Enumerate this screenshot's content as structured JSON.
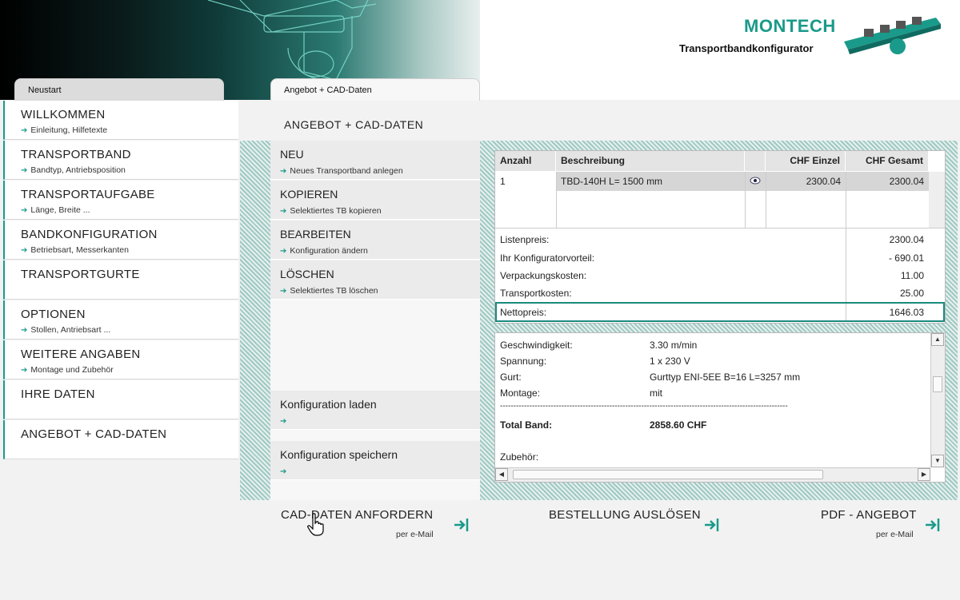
{
  "header": {
    "brand": "MONTECH",
    "subtitle": "Transportbandkonfigurator"
  },
  "tabs": [
    {
      "label": "Neustart"
    },
    {
      "label": "Angebot + CAD-Daten"
    }
  ],
  "left_nav": [
    {
      "title": "WILLKOMMEN",
      "sub": "Einleitung, Hilfetexte"
    },
    {
      "title": "TRANSPORTBAND",
      "sub": "Bandtyp, Antriebsposition"
    },
    {
      "title": "TRANSPORTAUFGABE",
      "sub": "Länge, Breite ..."
    },
    {
      "title": "BANDKONFIGURATION",
      "sub": "Betriebsart, Messerkanten"
    },
    {
      "title": "TRANSPORTGURTE",
      "sub": ""
    },
    {
      "title": "OPTIONEN",
      "sub": "Stollen, Antriebsart ..."
    },
    {
      "title": "WEITERE ANGABEN",
      "sub": "Montage und Zubehör"
    },
    {
      "title": "IHRE DATEN",
      "sub": ""
    },
    {
      "title": "ANGEBOT + CAD-DATEN",
      "sub": ""
    }
  ],
  "content_title": "ANGEBOT + CAD-DATEN",
  "actions": [
    {
      "title": "NEU",
      "sub": "Neues Transportband anlegen"
    },
    {
      "title": "KOPIEREN",
      "sub": "Selektiertes TB kopieren"
    },
    {
      "title": "BEARBEITEN",
      "sub": "Konfiguration ändern"
    },
    {
      "title": "LÖSCHEN",
      "sub": "Selektiertes TB löschen"
    }
  ],
  "config_actions": [
    {
      "title": "Konfiguration laden"
    },
    {
      "title": "Konfiguration speichern"
    }
  ],
  "price_table": {
    "headers": [
      "Anzahl",
      "Beschreibung",
      "CHF Einzel",
      "CHF Gesamt"
    ],
    "rows": [
      {
        "anzahl": "1",
        "beschreibung": "TBD-140H L= 1500 mm",
        "einzel": "2300.04",
        "gesamt": "2300.04"
      }
    ],
    "summary": [
      {
        "label": "Listenpreis:",
        "value": "2300.04"
      },
      {
        "label": "Ihr Konfiguratorvorteil:",
        "value": "- 690.01"
      },
      {
        "label": "Verpackungskosten:",
        "value": "11.00"
      },
      {
        "label": "Transportkosten:",
        "value": "25.00"
      }
    ],
    "netto": {
      "label": "Nettopreis:",
      "value": "1646.03"
    }
  },
  "details": {
    "rows": [
      {
        "label": "Geschwindigkeit:",
        "value": "3.30 m/min"
      },
      {
        "label": "Spannung:",
        "value": "1 x 230 V"
      },
      {
        "label": "Gurt:",
        "value": "Gurttyp ENI-5EE B=16 L=3257 mm"
      },
      {
        "label": "Montage:",
        "value": "mit"
      }
    ],
    "separator": "------------------------------------------------------------------------------------------------------------",
    "total_label": "Total Band:",
    "total_value": "2858.60 CHF",
    "zubehoer_label": "Zubehör:"
  },
  "bottom_actions": [
    {
      "title": "CAD-DATEN ANFORDERN",
      "sub": "per e-Mail"
    },
    {
      "title": "BESTELLUNG AUSLÖSEN",
      "sub": ""
    },
    {
      "title": "PDF - ANGEBOT",
      "sub": "per e-Mail"
    }
  ],
  "colors": {
    "accent": "#1a9a8a",
    "accent_dark": "#1a8a7e"
  }
}
